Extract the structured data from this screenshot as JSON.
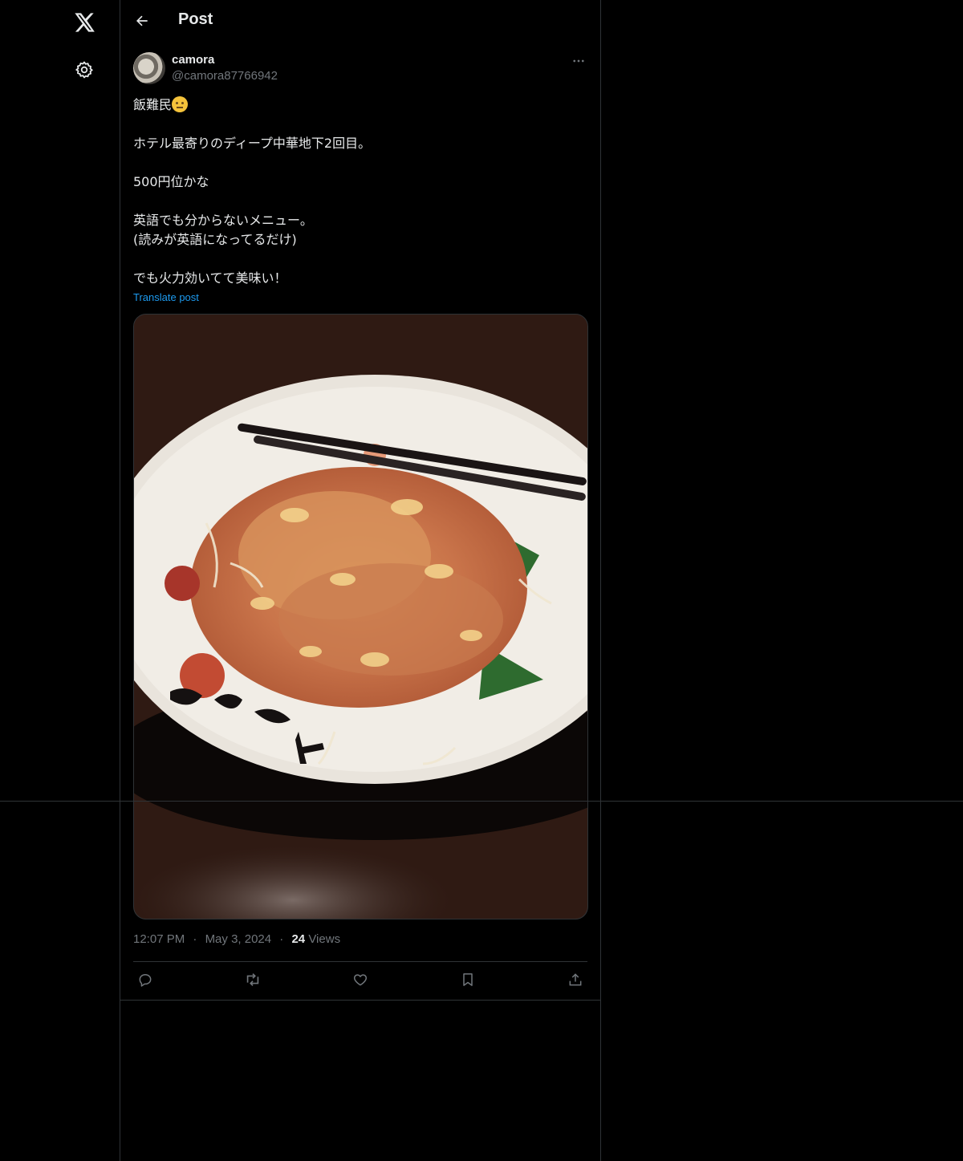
{
  "colors": {
    "background": "#000000",
    "text_primary": "#e7e9ea",
    "text_secondary": "#71767b",
    "accent_link": "#1d9bf0",
    "border": "#2f3336"
  },
  "left_rail": {
    "items": [
      {
        "icon": "x-logo-icon"
      },
      {
        "icon": "gear-icon"
      }
    ]
  },
  "header": {
    "back_icon": "arrow-left-icon",
    "title": "Post"
  },
  "author": {
    "name": "camora",
    "handle": "@camora87766942",
    "more_icon": "ellipsis-icon"
  },
  "post": {
    "lines": [
      "飯難民",
      "",
      "ホテル最寄りのディープ中華地下2回目。",
      "",
      "500円位かな",
      "",
      "英語でも分からないメニュー。",
      "(読みが英語になってるだけ)",
      "",
      "でも火力効いてて美味い！"
    ],
    "first_line_emoji": "face-with-rolling-eyes",
    "translate_label": "Translate post"
  },
  "media": {
    "kind": "photo",
    "subject": "plate of stir-fried noodles with chopsticks",
    "plate_text": "大排档门"
  },
  "meta": {
    "time": "12:07 PM",
    "separator": "·",
    "date": "May 3, 2024",
    "views_count": "24",
    "views_label": "Views"
  },
  "actions": [
    {
      "name": "reply",
      "icon": "reply-icon"
    },
    {
      "name": "repost",
      "icon": "repost-icon"
    },
    {
      "name": "like",
      "icon": "heart-icon"
    },
    {
      "name": "bookmark",
      "icon": "bookmark-icon"
    },
    {
      "name": "share",
      "icon": "share-icon"
    }
  ]
}
